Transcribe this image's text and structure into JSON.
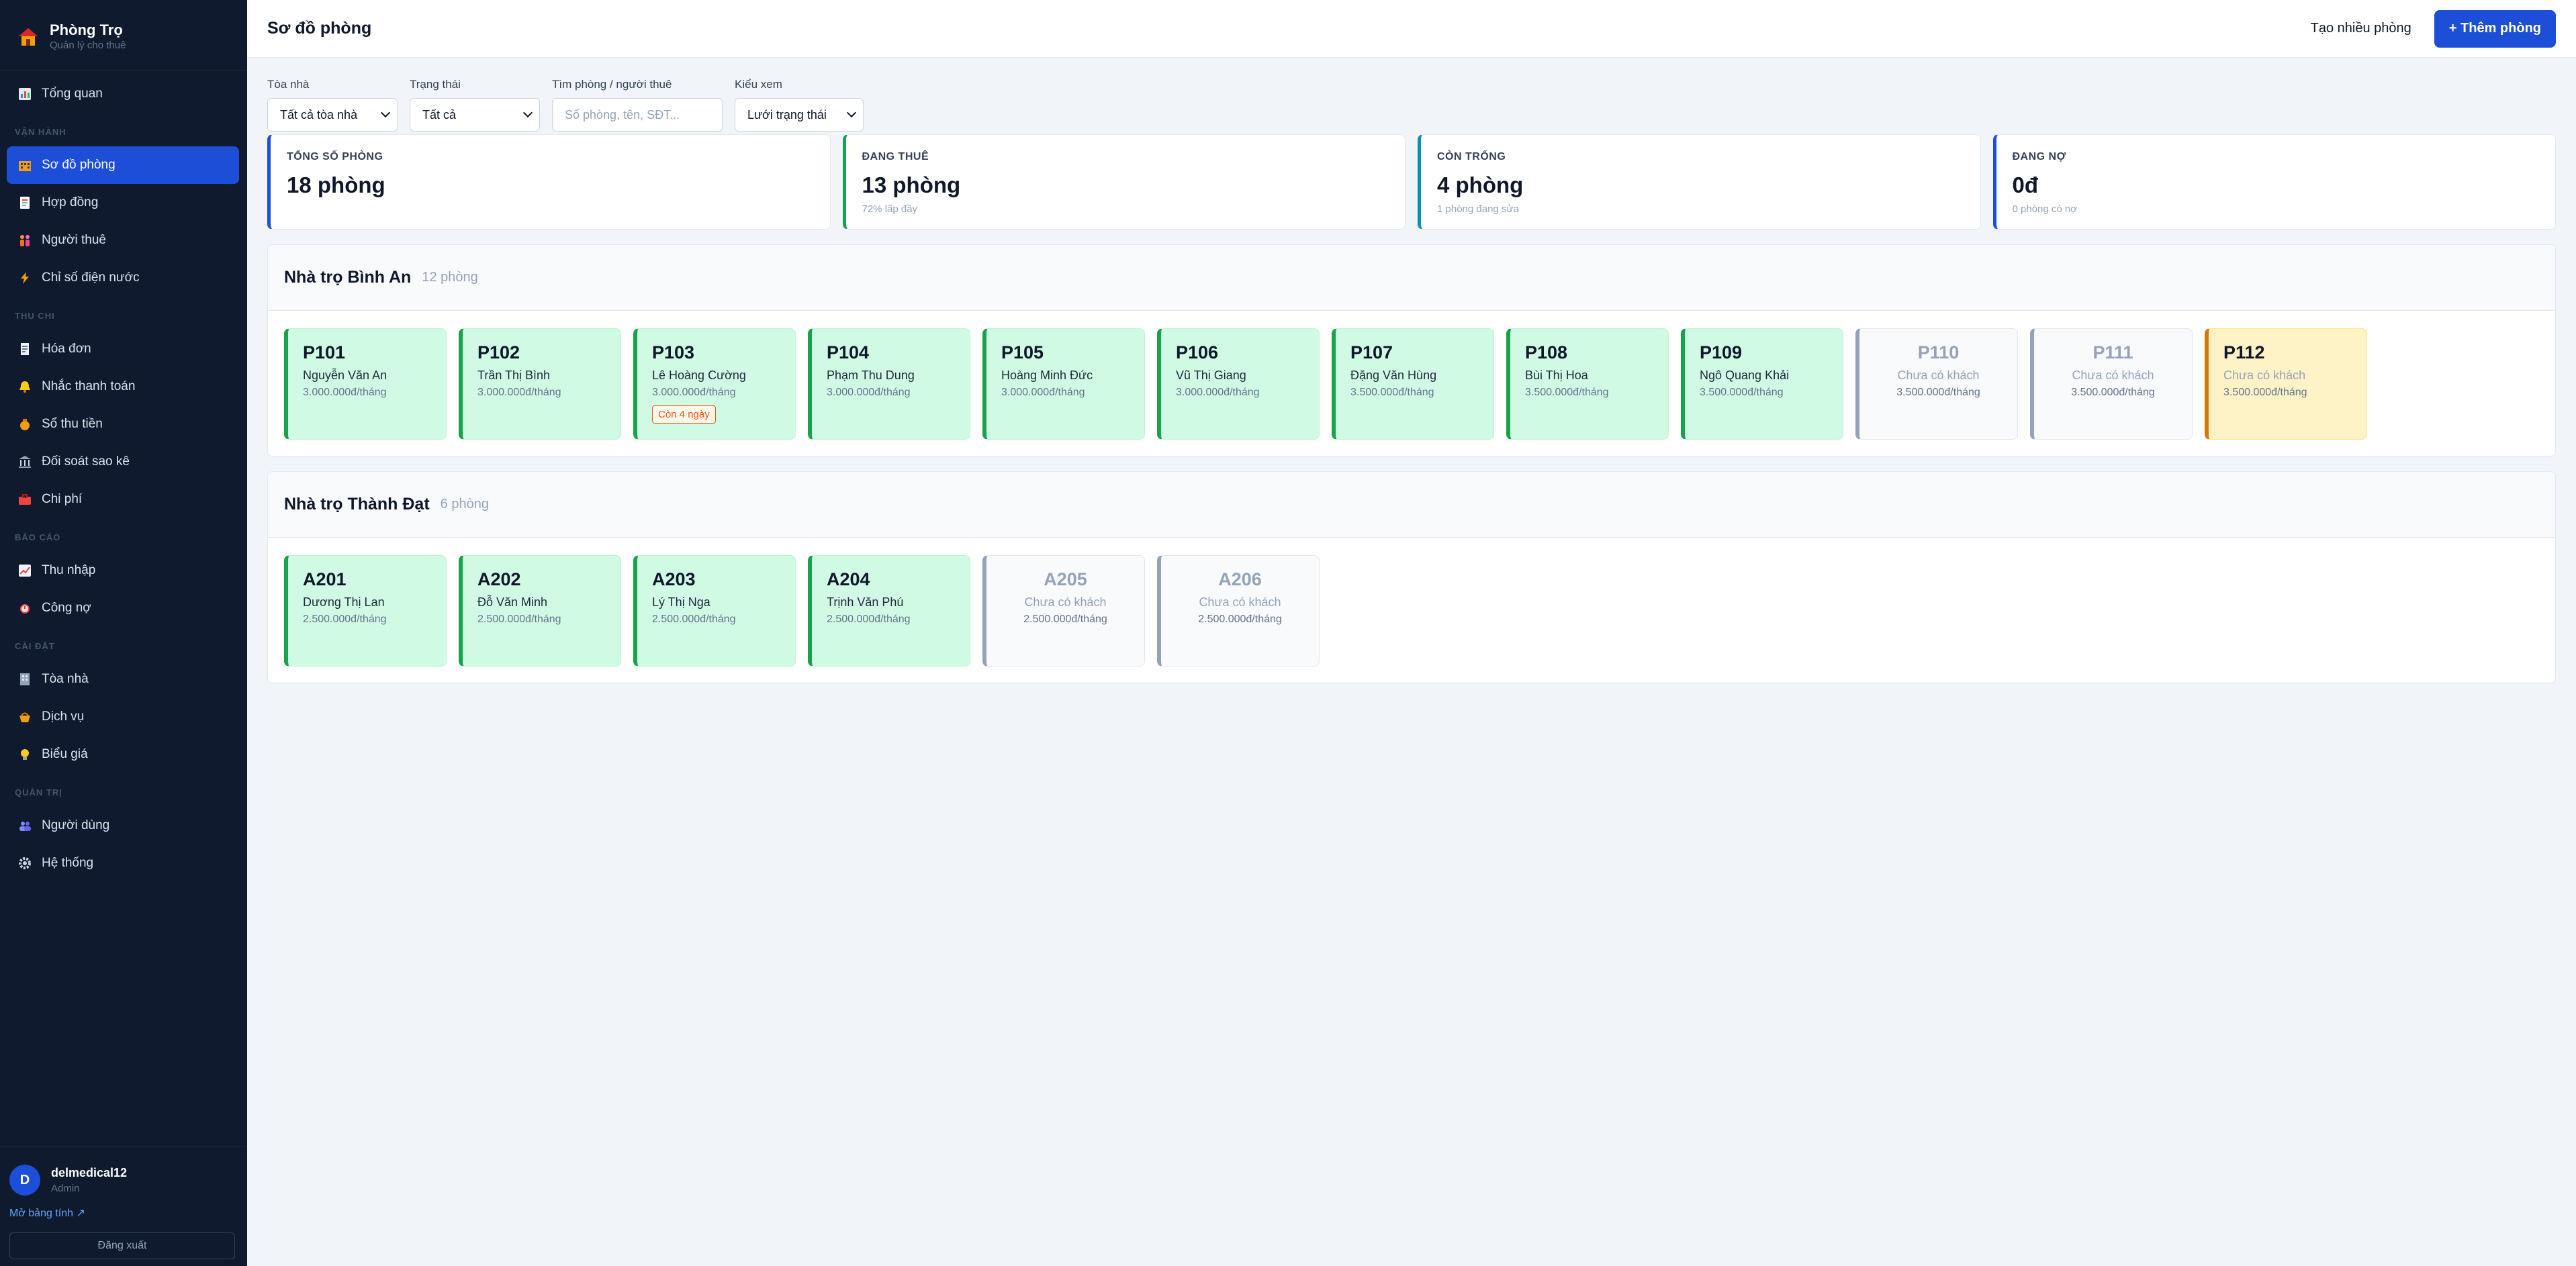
{
  "brand": {
    "title": "Phòng Trọ",
    "subtitle": "Quản lý cho thuê"
  },
  "nav": {
    "overview": "Tổng quan",
    "sec_ops": "VẬN HÀNH",
    "rooms_map": "Sơ đồ phòng",
    "contracts": "Hợp đồng",
    "tenants": "Người thuê",
    "meters": "Chỉ số điện nước",
    "sec_collect": "THU CHI",
    "invoices": "Hóa đơn",
    "reminders": "Nhắc thanh toán",
    "cashbook": "Sổ thu tiền",
    "reconcile": "Đối soát sao kê",
    "expenses": "Chi phí",
    "sec_reports": "BÁO CÁO",
    "income": "Thu nhập",
    "debts": "Công nợ",
    "sec_settings": "CÀI ĐẶT",
    "buildings": "Tòa nhà",
    "services": "Dịch vụ",
    "pricing": "Biểu giá",
    "sec_admin": "QUẢN TRỊ",
    "users": "Người dùng",
    "system": "Hệ thống"
  },
  "user": {
    "initial": "D",
    "name": "delmedical12",
    "role": "Admin",
    "sheet_link": "Mở bảng tính ↗",
    "logout": "Đăng xuất"
  },
  "header": {
    "title": "Sơ đồ phòng",
    "bulk_add": "Tạo nhiều phòng",
    "add_room": "+ Thêm phòng"
  },
  "filters": {
    "building_label": "Tòa nhà",
    "building_value": "Tất cả tòa nhà",
    "status_label": "Trạng thái",
    "status_value": "Tất cả",
    "search_label": "Tìm phòng / người thuê",
    "search_placeholder": "Số phòng, tên, SĐT...",
    "view_label": "Kiểu xem",
    "view_value": "Lưới trạng thái"
  },
  "stats": {
    "total": {
      "label": "TỔNG SỐ PHÒNG",
      "value": "18 phòng",
      "sub": ""
    },
    "rented": {
      "label": "ĐANG THUÊ",
      "value": "13 phòng",
      "sub": "72% lấp đầy"
    },
    "vacant": {
      "label": "CÒN TRỐNG",
      "value": "4 phòng",
      "sub": "1 phòng đang sửa"
    },
    "debt": {
      "label": "ĐANG NỢ",
      "value": "0đ",
      "sub": "0 phòng có nợ"
    }
  },
  "buildings": [
    {
      "name": "Nhà trọ Bình An",
      "count": "12 phòng",
      "rooms": [
        {
          "code": "P101",
          "tenant": "Nguyễn Văn An",
          "price": "3.000.000đ/tháng"
        },
        {
          "code": "P102",
          "tenant": "Trần Thị Bình",
          "price": "3.000.000đ/tháng"
        },
        {
          "code": "P103",
          "tenant": "Lê Hoàng Cường",
          "price": "3.000.000đ/tháng",
          "badge": "Còn 4 ngày"
        },
        {
          "code": "P104",
          "tenant": "Phạm Thu Dung",
          "price": "3.000.000đ/tháng"
        },
        {
          "code": "P105",
          "tenant": "Hoàng Minh Đức",
          "price": "3.000.000đ/tháng"
        },
        {
          "code": "P106",
          "tenant": "Vũ Thị Giang",
          "price": "3.000.000đ/tháng"
        },
        {
          "code": "P107",
          "tenant": "Đặng Văn Hùng",
          "price": "3.500.000đ/tháng"
        },
        {
          "code": "P108",
          "tenant": "Bùi Thị Hoa",
          "price": "3.500.000đ/tháng"
        },
        {
          "code": "P109",
          "tenant": "Ngô Quang Khải",
          "price": "3.500.000đ/tháng"
        },
        {
          "code": "P110",
          "tenant": "Chưa có khách",
          "price": "3.500.000đ/tháng"
        },
        {
          "code": "P111",
          "tenant": "Chưa có khách",
          "price": "3.500.000đ/tháng"
        },
        {
          "code": "P112",
          "tenant": "Chưa có khách",
          "price": "3.500.000đ/tháng"
        }
      ]
    },
    {
      "name": "Nhà trọ Thành Đạt",
      "count": "6 phòng",
      "rooms": [
        {
          "code": "A201",
          "tenant": "Dương Thị Lan",
          "price": "2.500.000đ/tháng"
        },
        {
          "code": "A202",
          "tenant": "Đỗ Văn Minh",
          "price": "2.500.000đ/tháng"
        },
        {
          "code": "A203",
          "tenant": "Lý Thị Nga",
          "price": "2.500.000đ/tháng"
        },
        {
          "code": "A204",
          "tenant": "Trịnh Văn Phú",
          "price": "2.500.000đ/tháng"
        },
        {
          "code": "A205",
          "tenant": "Chưa có khách",
          "price": "2.500.000đ/tháng"
        },
        {
          "code": "A206",
          "tenant": "Chưa có khách",
          "price": "2.500.000đ/tháng"
        }
      ]
    }
  ]
}
